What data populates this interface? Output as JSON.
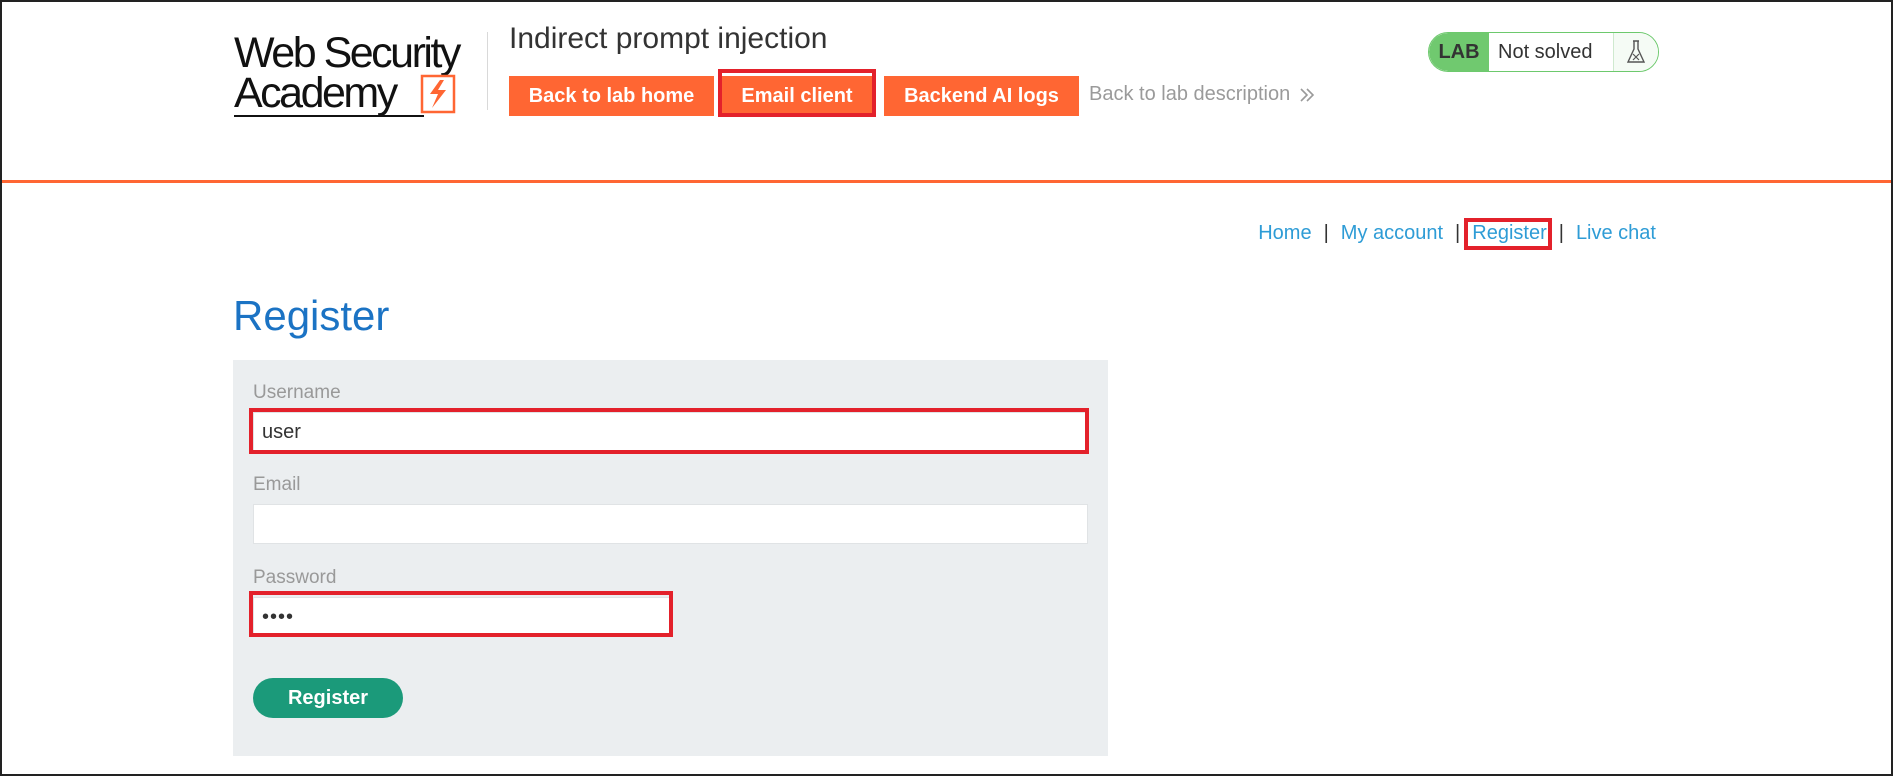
{
  "header": {
    "logo_line1": "Web Security",
    "logo_line2": "Academy",
    "lab_title": "Indirect prompt injection",
    "buttons": {
      "back_to_lab_home": "Back to lab home",
      "email_client": "Email client",
      "backend_ai_logs": "Backend AI logs"
    },
    "back_to_description": "Back to lab description",
    "back_icon": "double-chevron-right-icon",
    "lab_status": {
      "badge": "LAB",
      "status": "Not solved",
      "icon": "flask-icon"
    }
  },
  "top_nav": {
    "home": "Home",
    "my_account": "My account",
    "register": "Register",
    "live_chat": "Live chat",
    "separator": "|"
  },
  "page": {
    "title": "Register"
  },
  "form": {
    "username_label": "Username",
    "username_value": "user",
    "email_label": "Email",
    "email_value": "",
    "password_label": "Password",
    "password_value": "••••",
    "submit_label": "Register"
  },
  "colors": {
    "accent": "#ff6633",
    "link": "#2e9cd6",
    "title": "#1b73c4",
    "submit": "#1b9a7a",
    "lab_green": "#70c96f",
    "highlight": "#e3212b"
  }
}
